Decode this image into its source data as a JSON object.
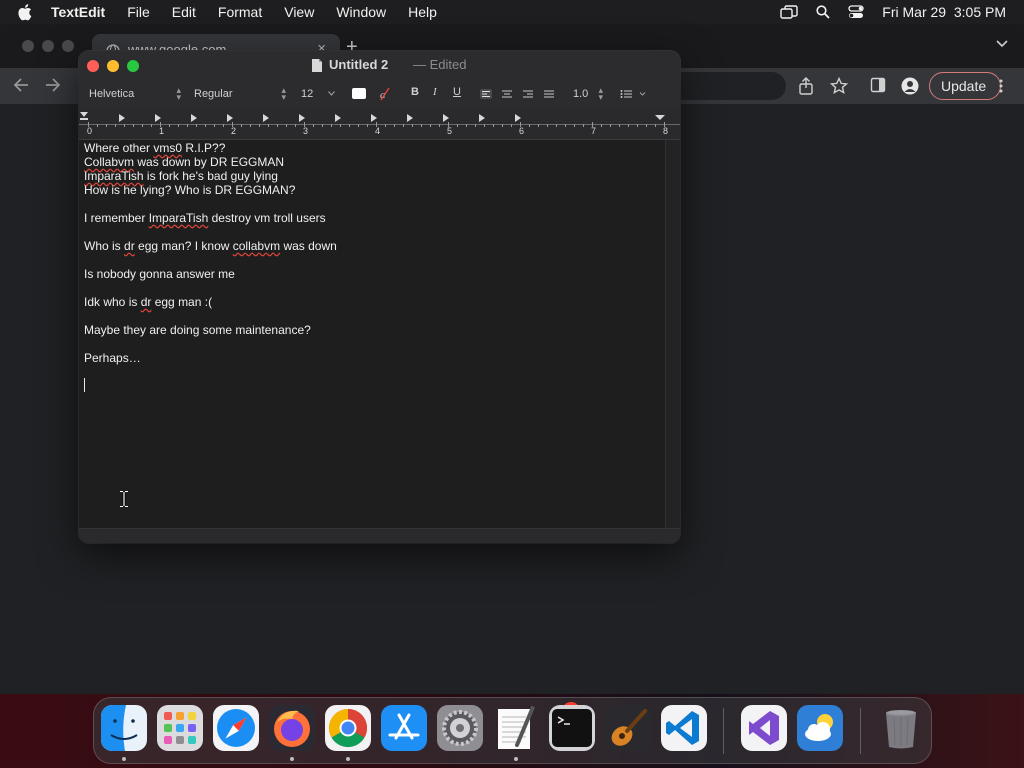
{
  "menubar": {
    "app_name": "TextEdit",
    "items": [
      "File",
      "Edit",
      "Format",
      "View",
      "Window",
      "Help"
    ],
    "datetime": "Fri Mar 29  3:05 PM"
  },
  "chrome": {
    "tab_title": "www.google.com",
    "tab_close": "×",
    "new_tab": "+",
    "update_label": "Update"
  },
  "textedit": {
    "title": "Untitled 2",
    "separator": "—",
    "status": "Edited",
    "font_family": "Helvetica",
    "font_style": "Regular",
    "font_size": "12",
    "bold": "B",
    "italic": "I",
    "underline": "U",
    "line_spacing": "1.0",
    "ruler_numbers": [
      "0",
      "1",
      "2",
      "3",
      "4",
      "5",
      "6",
      "7",
      "8"
    ],
    "lines": {
      "l1": [
        "Where other ",
        "vms0",
        " R.I.P??"
      ],
      "l2": [
        "",
        "Collabvm",
        " was down by DR EGGMAN"
      ],
      "l3": [
        "",
        "ImparaTish",
        " is fork he's bad guy lying"
      ],
      "l4": "How is he lying? Who is DR EGGMAN?",
      "l5": [
        "I remember ",
        "ImparaTish",
        " destroy vm troll users"
      ],
      "l6": [
        "Who is ",
        "dr",
        " egg man? I know ",
        "collabvm",
        " was down"
      ],
      "l7": "Is nobody gonna answer me",
      "l8": [
        "Idk who is ",
        "dr",
        " egg man :("
      ],
      "l9": "Maybe they are doing some maintenance?",
      "l10": "Perhaps…"
    }
  },
  "dock": {
    "settings_badge": "1",
    "apps": [
      "Finder",
      "Launchpad",
      "Safari",
      "Firefox",
      "Google Chrome",
      "App Store",
      "System Settings",
      "TextEdit",
      "Terminal",
      "GarageBand",
      "Visual Studio Code",
      "Visual Studio",
      "Weather",
      "Trash"
    ]
  },
  "colors": {
    "close": "#ff5f57",
    "minimize": "#febc2e",
    "zoom": "#28c840",
    "spell_underline": "#e0453a"
  }
}
